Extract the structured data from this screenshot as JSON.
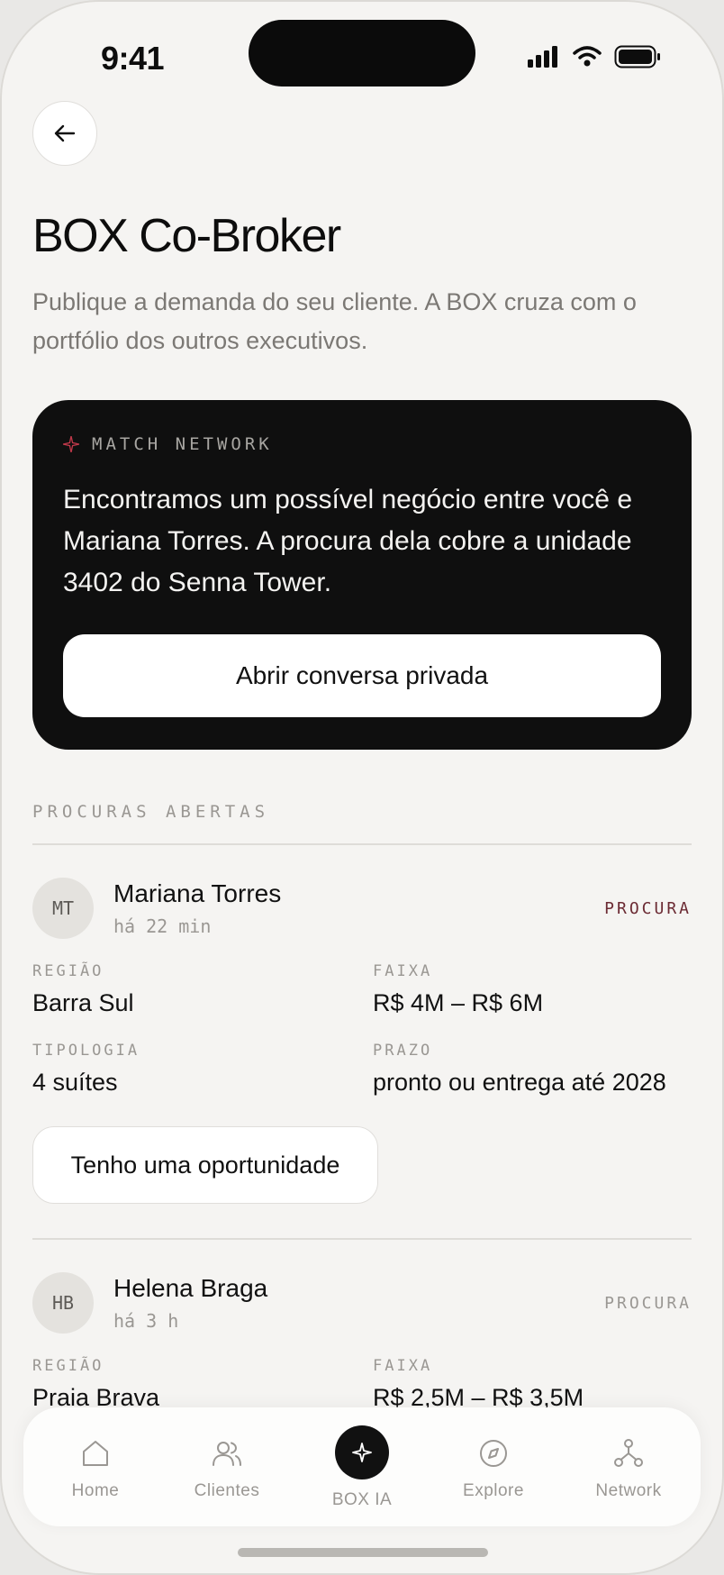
{
  "status_bar": {
    "time": "9:41"
  },
  "header": {
    "title": "BOX Co-Broker",
    "subtitle": "Publique a demanda do seu cliente. A BOX cruza com o portfólio dos outros executivos."
  },
  "match_card": {
    "tag": "MATCH NETWORK",
    "text": "Encontramos um possível negócio entre você e Mariana Torres. A procura dela cobre a unidade 3402 do Senna Tower.",
    "cta": "Abrir conversa privada"
  },
  "section": {
    "label": "PROCURAS ABERTAS"
  },
  "requests": [
    {
      "initials": "MT",
      "name": "Mariana Torres",
      "time": "há 22 min",
      "badge": "PROCURA",
      "region_label": "REGIÃO",
      "region": "Barra Sul",
      "range_label": "FAIXA",
      "range": "R$ 4M – R$ 6M",
      "type_label": "TIPOLOGIA",
      "type": "4 suítes",
      "deadline_label": "PRAZO",
      "deadline": "pronto ou entrega até 2028",
      "action": "Tenho uma oportunidade"
    },
    {
      "initials": "HB",
      "name": "Helena Braga",
      "time": "há 3 h",
      "badge": "PROCURA",
      "region_label": "REGIÃO",
      "region": "Praia Brava",
      "range_label": "FAIXA",
      "range": "R$ 2,5M – R$ 3,5M"
    }
  ],
  "tabbar": {
    "items": [
      {
        "label": "Home",
        "icon": "home-icon"
      },
      {
        "label": "Clientes",
        "icon": "users-icon"
      },
      {
        "label": "BOX IA",
        "icon": "sparkle-icon"
      },
      {
        "label": "Explore",
        "icon": "compass-icon"
      },
      {
        "label": "Network",
        "icon": "network-icon"
      }
    ]
  },
  "colors": {
    "background": "#f5f4f2",
    "card_dark": "#0f0f0f",
    "accent_badge": "#6b2a33",
    "sparkle": "#c0394a",
    "muted_text": "#9a9793"
  }
}
